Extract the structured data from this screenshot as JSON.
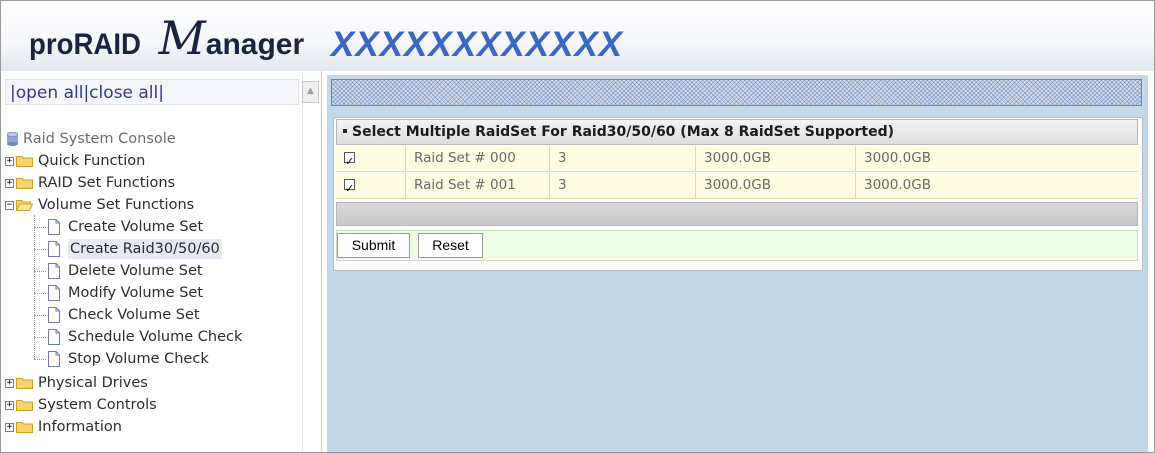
{
  "header": {
    "brand_pro": "proRAID",
    "brand_m": "M",
    "brand_rest": "anager",
    "model": "XXXXXXXXXXXX"
  },
  "nav": {
    "open_all": "open all",
    "close_all": "close all",
    "sep_left": "|",
    "sep_mid": "|",
    "sep_right": "|",
    "root": "Raid System Console",
    "items": [
      {
        "label": "Quick Function",
        "expander": "+"
      },
      {
        "label": "RAID Set Functions",
        "expander": "+"
      },
      {
        "label": "Volume Set Functions",
        "expander": "−"
      },
      {
        "label": "Physical Drives",
        "expander": "+"
      },
      {
        "label": "System Controls",
        "expander": "+"
      },
      {
        "label": "Information",
        "expander": "+"
      }
    ],
    "volume_children": [
      "Create Volume Set",
      "Create Raid30/50/60",
      "Delete Volume Set",
      "Modify Volume Set",
      "Check Volume Set",
      "Schedule Volume Check",
      "Stop Volume Check"
    ],
    "selected": "Create Raid30/50/60"
  },
  "panel": {
    "title": "Select Multiple RaidSet For Raid30/50/60 (Max 8 RaidSet Supported)",
    "rows": [
      {
        "checked": true,
        "name": "Raid Set # 000",
        "disks": "3",
        "total": "3000.0GB",
        "free": "3000.0GB"
      },
      {
        "checked": true,
        "name": "Raid Set # 001",
        "disks": "3",
        "total": "3000.0GB",
        "free": "3000.0GB"
      }
    ],
    "submit_label": "Submit",
    "reset_label": "Reset"
  },
  "colors": {
    "model_text": "#3b66c4",
    "content_bg": "#c3d9ea",
    "row_bg": "#fffbe1",
    "button_row_bg": "#eefde6"
  }
}
